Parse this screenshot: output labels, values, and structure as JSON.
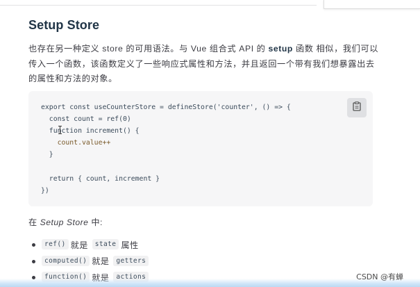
{
  "section": {
    "title": "Setup Store",
    "intro_before": "也存在另一种定义 store 的可用语法。与 Vue 组合式 API 的 ",
    "intro_setup": "setup",
    "intro_after": " 函数 相似，我们可以传入一个函数，该函数定义了一些响应式属性和方法，并且返回一个带有我们想暴露出去的属性和方法的对象。"
  },
  "code": {
    "lines": [
      "export const useCounterStore = defineStore('counter', () => {",
      "  const count = ref(0)",
      "  function increment() {",
      "    count.value++",
      "  }",
      "",
      "  return { count, increment }",
      "})"
    ],
    "copy_icon": "clipboard-icon"
  },
  "subheading": {
    "prefix": "在 ",
    "emphasis": "Setup Store",
    "suffix": " 中:"
  },
  "mappings": [
    {
      "code": "ref()",
      "word": "就是",
      "target": "state",
      "suffix": "属性"
    },
    {
      "code": "computed()",
      "word": "就是",
      "target": "getters",
      "suffix": ""
    },
    {
      "code": "function()",
      "word": "就是",
      "target": "actions",
      "suffix": ""
    }
  ],
  "watermark": "CSDN @有蝉"
}
